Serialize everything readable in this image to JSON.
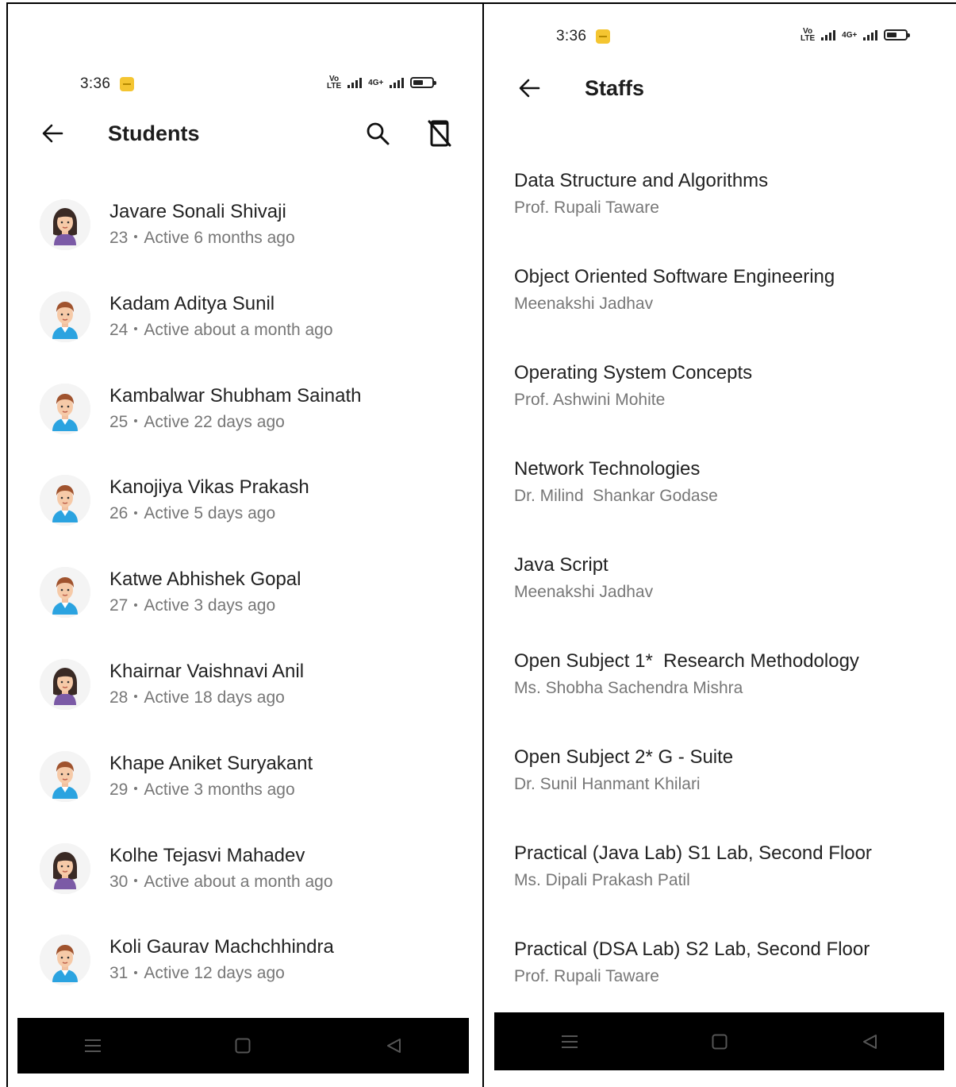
{
  "left": {
    "status": {
      "time": "3:36",
      "net1": "VoB LTE",
      "net2": "4G+"
    },
    "app_bar": {
      "title": "Students"
    },
    "icons": {
      "back": "arrow-back-icon",
      "search": "search-icon",
      "action": "phone-off-icon"
    },
    "students": [
      {
        "name": "Javare Sonali Shivaji",
        "roll": "23",
        "active": "Active 6 months ago",
        "avatar": "female"
      },
      {
        "name": "Kadam Aditya Sunil",
        "roll": "24",
        "active": "Active about a month ago",
        "avatar": "male"
      },
      {
        "name": "Kambalwar Shubham Sainath",
        "roll": "25",
        "active": "Active 22 days ago",
        "avatar": "male"
      },
      {
        "name": "Kanojiya Vikas Prakash",
        "roll": "26",
        "active": "Active 5 days ago",
        "avatar": "male"
      },
      {
        "name": "Katwe Abhishek Gopal",
        "roll": "27",
        "active": "Active 3 days ago",
        "avatar": "male"
      },
      {
        "name": "Khairnar Vaishnavi Anil",
        "roll": "28",
        "active": "Active 18 days ago",
        "avatar": "female"
      },
      {
        "name": "Khape Aniket Suryakant",
        "roll": "29",
        "active": "Active 3 months ago",
        "avatar": "male"
      },
      {
        "name": "Kolhe Tejasvi Mahadev",
        "roll": "30",
        "active": "Active about a month ago",
        "avatar": "female"
      },
      {
        "name": "Koli Gaurav Machchhindra",
        "roll": "31",
        "active": "Active 12 days ago",
        "avatar": "male"
      }
    ]
  },
  "right": {
    "status": {
      "time": "3:36",
      "net1": "VoB LTE",
      "net2": "4G+"
    },
    "app_bar": {
      "title": "Staffs"
    },
    "staffs": [
      {
        "subject": "Data Structure and Algorithms",
        "teacher": "Prof. Rupali Taware"
      },
      {
        "subject": "Object Oriented Software Engineering",
        "teacher": "Meenakshi Jadhav"
      },
      {
        "subject": "Operating System Concepts",
        "teacher": "Prof. Ashwini Mohite"
      },
      {
        "subject": "Network Technologies",
        "teacher": "Dr. Milind  Shankar Godase"
      },
      {
        "subject": "Java Script",
        "teacher": "Meenakshi Jadhav"
      },
      {
        "subject": "Open Subject 1*  Research Methodology",
        "teacher": "Ms. Shobha Sachendra Mishra"
      },
      {
        "subject": "Open Subject 2* G - Suite",
        "teacher": "Dr. Sunil Hanmant Khilari"
      },
      {
        "subject": "Practical (Java Lab) S1 Lab, Second Floor",
        "teacher": "Ms. Dipali Prakash Patil"
      },
      {
        "subject": "Practical (DSA Lab) S2 Lab, Second Floor",
        "teacher": "Prof. Rupali Taware"
      }
    ]
  },
  "nav": {
    "menu": "menu-icon",
    "home": "home-square-icon",
    "back": "back-triangle-icon"
  },
  "colors": {
    "nav_bg": "#000000",
    "notif": "#f4c531",
    "secondary_text": "#777777"
  }
}
